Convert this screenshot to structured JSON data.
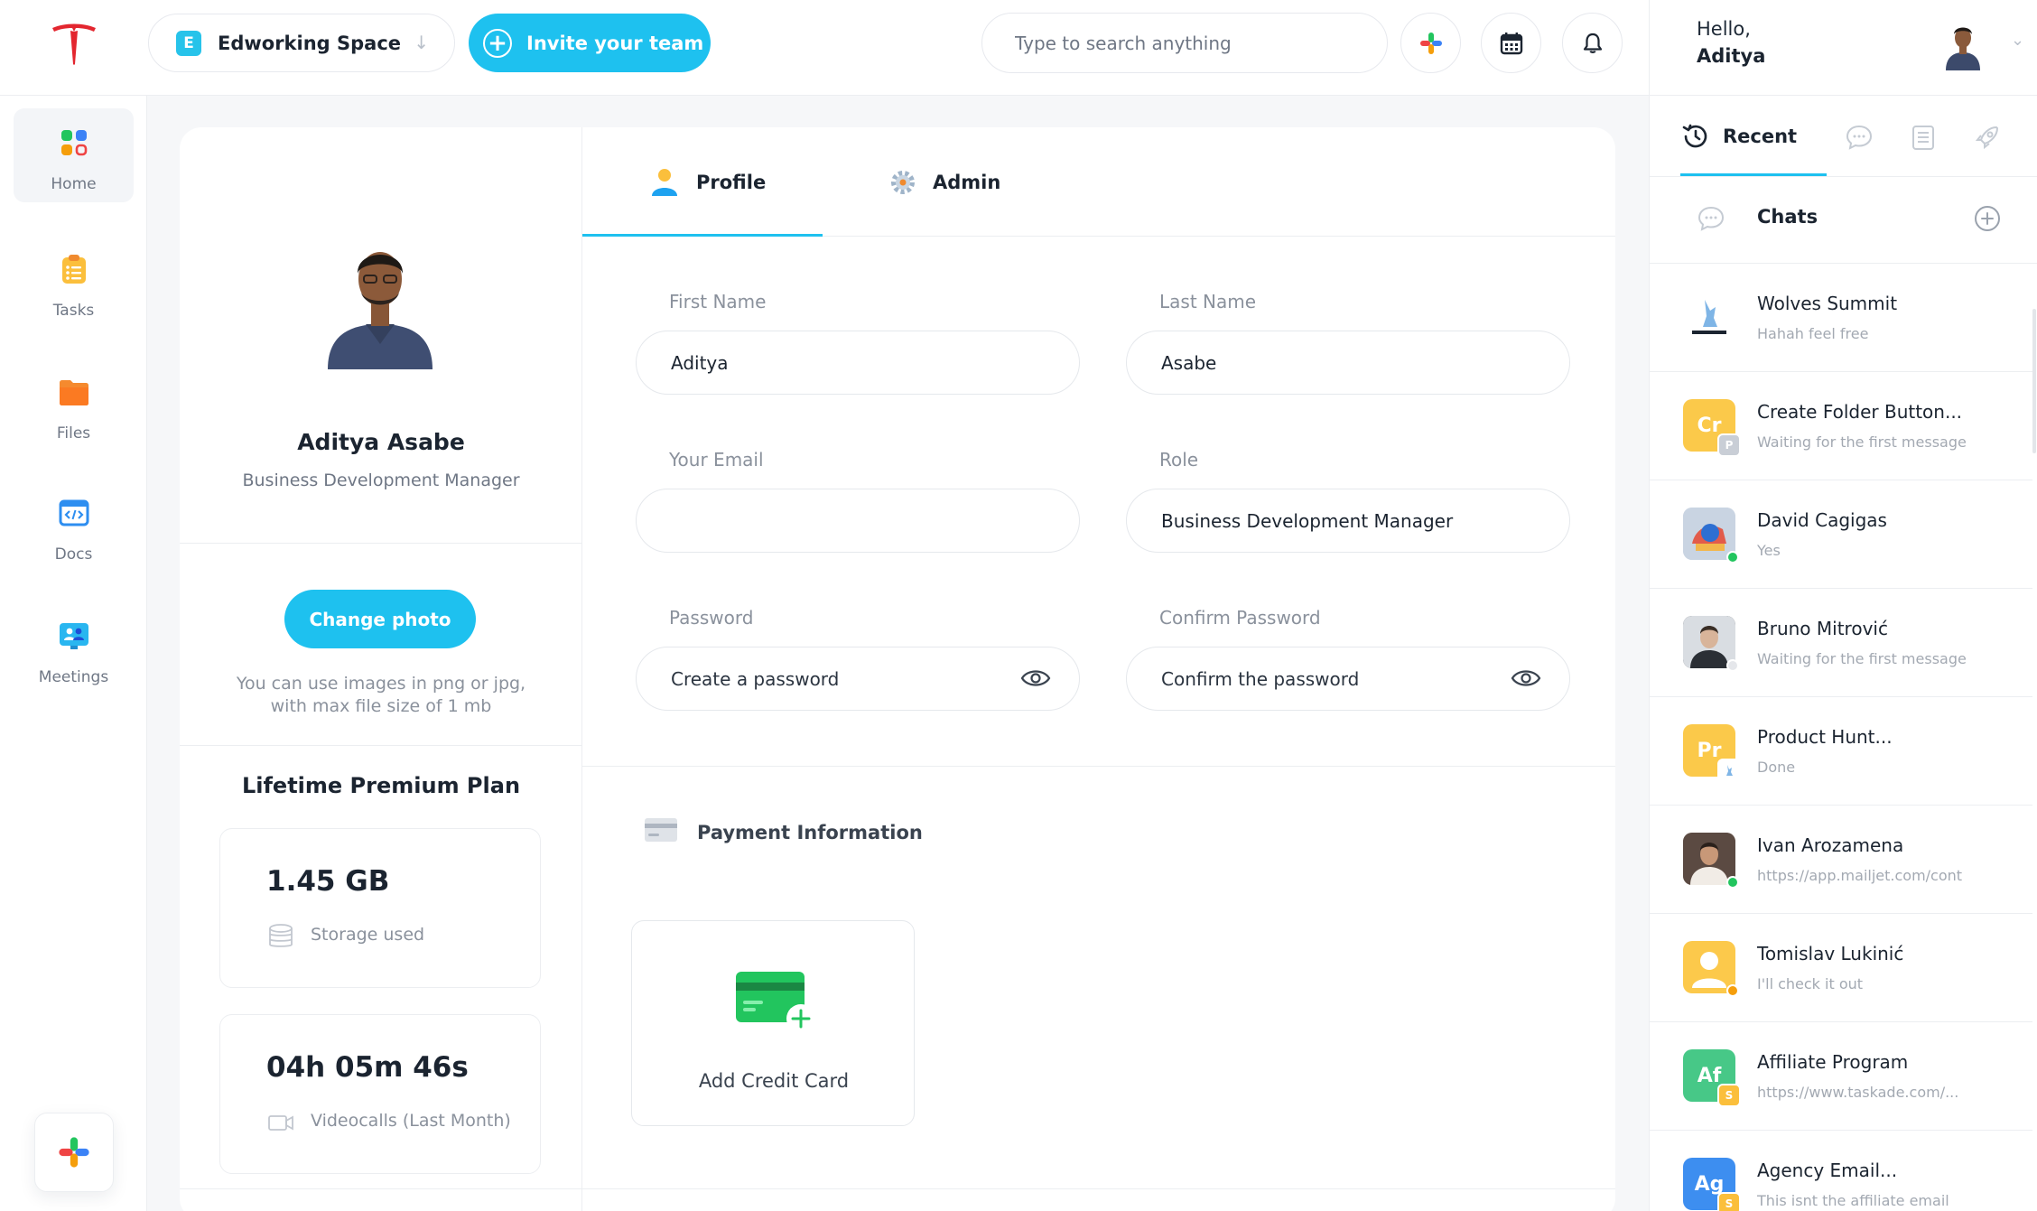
{
  "topbar": {
    "workspace_badge": "E",
    "workspace_name": "Edworking Space",
    "invite_label": "Invite your team",
    "search_placeholder": "Type to search anything"
  },
  "user": {
    "greeting": "Hello,",
    "name": "Aditya"
  },
  "sidebar": {
    "items": [
      {
        "label": "Home"
      },
      {
        "label": "Tasks"
      },
      {
        "label": "Files"
      },
      {
        "label": "Docs"
      },
      {
        "label": "Meetings"
      }
    ]
  },
  "profile": {
    "full_name": "Aditya Asabe",
    "role": "Business Development Manager",
    "change_photo_label": "Change photo",
    "photo_hint": "You can use images in png or jpg, with max file size of 1 mb",
    "plan_title": "Lifetime Premium Plan",
    "storage_value": "1.45 GB",
    "storage_label": "Storage used",
    "videocall_value": "04h 05m 46s",
    "videocall_label": "Videocalls (Last Month)"
  },
  "tabs": {
    "profile": "Profile",
    "admin": "Admin"
  },
  "form": {
    "first_name_label": "First Name",
    "first_name_value": "Aditya",
    "last_name_label": "Last Name",
    "last_name_value": "Asabe",
    "email_label": "Your Email",
    "role_label": "Role",
    "role_value": "Business Development Manager",
    "password_label": "Password",
    "password_placeholder": "Create a password",
    "confirm_label": "Confirm Password",
    "confirm_placeholder": "Confirm the password"
  },
  "payment": {
    "title": "Payment Information",
    "add_card_label": "Add Credit Card"
  },
  "panel": {
    "recent_label": "Recent",
    "chats_title": "Chats",
    "chats": [
      {
        "name": "Wolves Summit",
        "preview": "Hahah feel free",
        "avatar_text": "",
        "color": "#ffffff"
      },
      {
        "name": "Create Folder Button...",
        "preview": "Waiting for the first message",
        "avatar_text": "Cr",
        "color": "#fbc94a",
        "badge": "P"
      },
      {
        "name": "David Cagigas",
        "preview": "Yes",
        "avatar_text": "",
        "color": "#c9d4e2"
      },
      {
        "name": "Bruno Mitrović",
        "preview": "Waiting for the first message",
        "avatar_text": "",
        "color": "#3b3f46"
      },
      {
        "name": "Product Hunt...",
        "preview": "Done",
        "avatar_text": "Pr",
        "color": "#fbc94a"
      },
      {
        "name": "Ivan Arozamena",
        "preview": "https://app.mailjet.com/cont",
        "avatar_text": "",
        "color": "#8d7468"
      },
      {
        "name": "Tomislav Lukinić",
        "preview": "I'll check it out",
        "avatar_text": "",
        "color": "#fcc94b"
      },
      {
        "name": "Affiliate Program",
        "preview": "https://www.taskade.com/...",
        "avatar_text": "Af",
        "color": "#47c887",
        "badge": "S"
      },
      {
        "name": "Agency Email...",
        "preview": "This isnt the affiliate email",
        "avatar_text": "Ag",
        "color": "#3d8ef0",
        "badge": "S"
      }
    ]
  },
  "colors": {
    "accent": "#1ec1ef",
    "online": "#22c55e",
    "away": "#f59e0b"
  }
}
